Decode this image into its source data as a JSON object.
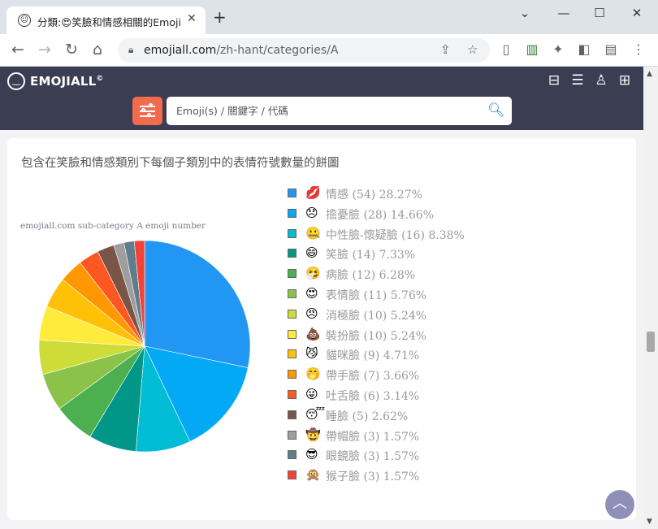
{
  "browser": {
    "tab_title": "分類:😍笑臉和情感相關的Emoji",
    "tab_favicon": "☺",
    "url_host": "emojiall.com",
    "url_path": "/zh-hant/categories/A"
  },
  "site": {
    "logo_text": "EMOJIALL",
    "logo_mark": "©",
    "search_placeholder": "Emoji(s) / 關鍵字 / 代碼"
  },
  "card": {
    "title": "包含在笑臉和情感類別下每個子類別中的表情符號數量的餅圖",
    "chart_caption": "emojiall.com sub-category A emoji number"
  },
  "chart_data": {
    "type": "pie",
    "title": "emojiall.com sub-category A emoji number",
    "legend_position": "right",
    "slices": [
      {
        "emoji": "💋",
        "label": "情感 (54) 28.27%",
        "name": "情感",
        "value": 54,
        "percent": 28.27,
        "color": "#2196f3"
      },
      {
        "emoji": "😞",
        "label": "擔憂臉 (28) 14.66%",
        "name": "擔憂臉",
        "value": 28,
        "percent": 14.66,
        "color": "#03a9f4"
      },
      {
        "emoji": "🤐",
        "label": "中性臉-懷疑臉 (16) 8.38%",
        "name": "中性臉-懷疑臉",
        "value": 16,
        "percent": 8.38,
        "color": "#00bcd4"
      },
      {
        "emoji": "😄",
        "label": "笑臉 (14) 7.33%",
        "name": "笑臉",
        "value": 14,
        "percent": 7.33,
        "color": "#009688"
      },
      {
        "emoji": "🤧",
        "label": "病臉 (12) 6.28%",
        "name": "病臉",
        "value": 12,
        "percent": 6.28,
        "color": "#4caf50"
      },
      {
        "emoji": "😍",
        "label": "表情臉 (11) 5.76%",
        "name": "表情臉",
        "value": 11,
        "percent": 5.76,
        "color": "#8bc34a"
      },
      {
        "emoji": "😠",
        "label": "消極臉 (10) 5.24%",
        "name": "消極臉",
        "value": 10,
        "percent": 5.24,
        "color": "#cddc39"
      },
      {
        "emoji": "💩",
        "label": "裝扮臉 (10) 5.24%",
        "name": "裝扮臉",
        "value": 10,
        "percent": 5.24,
        "color": "#ffeb3b"
      },
      {
        "emoji": "😼",
        "label": "貓咪臉 (9) 4.71%",
        "name": "貓咪臉",
        "value": 9,
        "percent": 4.71,
        "color": "#ffc107"
      },
      {
        "emoji": "🤭",
        "label": "帶手臉 (7) 3.66%",
        "name": "帶手臉",
        "value": 7,
        "percent": 3.66,
        "color": "#ff9800"
      },
      {
        "emoji": "😜",
        "label": "吐舌臉 (6) 3.14%",
        "name": "吐舌臉",
        "value": 6,
        "percent": 3.14,
        "color": "#ff5722"
      },
      {
        "emoji": "😴",
        "label": "睡臉 (5) 2.62%",
        "name": "睡臉",
        "value": 5,
        "percent": 2.62,
        "color": "#795548"
      },
      {
        "emoji": "🤠",
        "label": "帶帽臉 (3) 1.57%",
        "name": "帶帽臉",
        "value": 3,
        "percent": 1.57,
        "color": "#9e9e9e"
      },
      {
        "emoji": "😎",
        "label": "眼鏡臉 (3) 1.57%",
        "name": "眼鏡臉",
        "value": 3,
        "percent": 1.57,
        "color": "#607d8b"
      },
      {
        "emoji": "🙊",
        "label": "猴子臉 (3) 1.57%",
        "name": "猴子臉",
        "value": 3,
        "percent": 1.57,
        "color": "#f44336"
      }
    ]
  }
}
